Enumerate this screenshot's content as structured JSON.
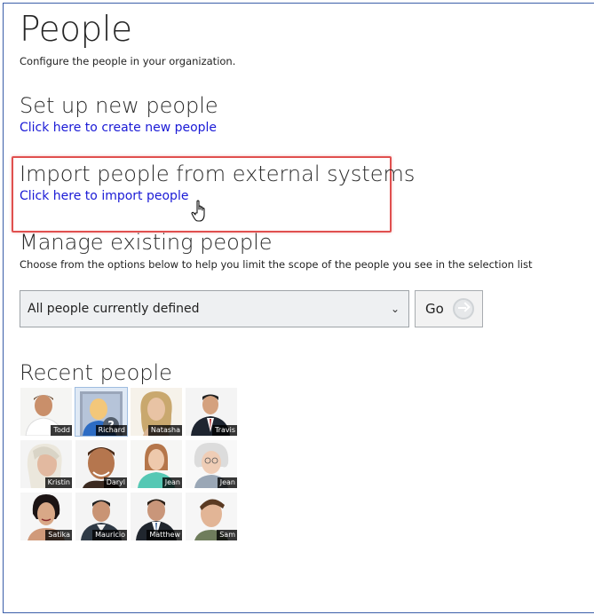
{
  "page": {
    "title": "People",
    "subtitle": "Configure the people in your organization."
  },
  "setup": {
    "heading": "Set up new people",
    "link": "Click here to create new people"
  },
  "import": {
    "heading": "Import people from external systems",
    "link": "Click here to import people"
  },
  "manage": {
    "heading": "Manage existing people",
    "description": "Choose from the options below to help you limit the scope of the people you see in the selection list",
    "filter_value": "All people currently defined",
    "go_label": "Go"
  },
  "recent": {
    "heading": "Recent people",
    "people": [
      {
        "name": "Todd"
      },
      {
        "name": "Richard"
      },
      {
        "name": "Natasha"
      },
      {
        "name": "Travis"
      },
      {
        "name": "Kristin"
      },
      {
        "name": "Daryl"
      },
      {
        "name": "Jean"
      },
      {
        "name": "Jean"
      },
      {
        "name": "Satika"
      },
      {
        "name": "Mauricio"
      },
      {
        "name": "Matthew"
      },
      {
        "name": "Sam"
      }
    ]
  },
  "colors": {
    "link": "#1a1ad6",
    "highlight": "#e0504f",
    "border": "#3b5ea8"
  },
  "icons": {
    "pointer": "hand-pointer-icon",
    "go": "arrow-right-circle-icon",
    "dropdown": "chevron-down-icon",
    "placeholder_avatar": "unknown-person-icon"
  }
}
